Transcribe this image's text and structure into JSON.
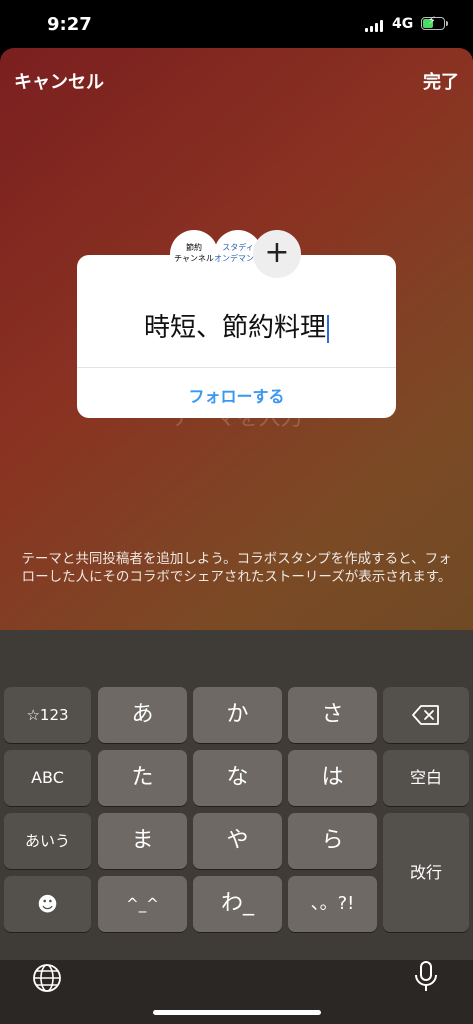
{
  "status": {
    "time": "9:27",
    "network": "4G"
  },
  "header": {
    "cancel": "キャンセル",
    "done": "完了"
  },
  "card": {
    "chip1_line1": "節約",
    "chip1_line2": "チャンネル",
    "chip2_line1": "スタディ",
    "chip2_line2": "オンデマント",
    "add_symbol": "+",
    "title": "時短、節約料理",
    "follow": "フォローする"
  },
  "ghost_text": "テーマを入力",
  "description": "テーマと共同投稿者を追加しよう。コラボスタンプを作成すると、フォローした人にそのコラボでシェアされたストーリーズが表示されます。",
  "keyboard": {
    "row1": [
      "☆123",
      "あ",
      "か",
      "さ"
    ],
    "row2": [
      "ABC",
      "た",
      "な",
      "は",
      "空白"
    ],
    "row3": [
      "あいう",
      "ま",
      "や",
      "ら"
    ],
    "row4": [
      "☻",
      "^_^",
      "わ_",
      "、。?!"
    ],
    "enter": "改行"
  },
  "icons": [
    "globe-icon",
    "microphone-icon",
    "delete-icon",
    "battery-icon",
    "signal-icon"
  ]
}
